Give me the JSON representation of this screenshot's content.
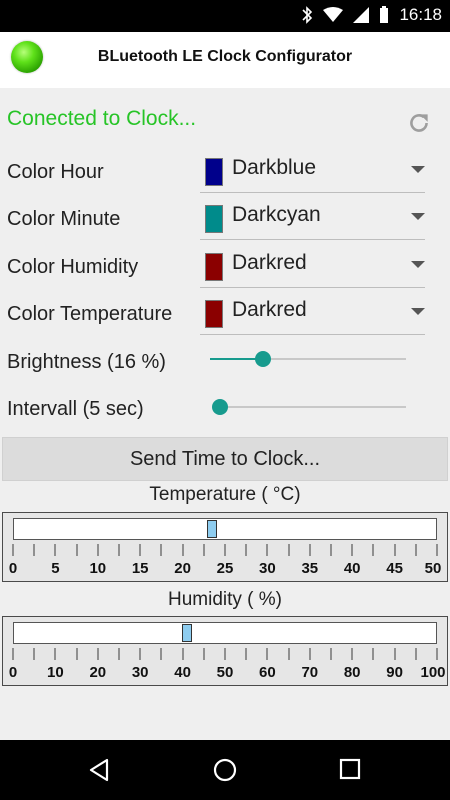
{
  "status_bar": {
    "time": "16:18"
  },
  "app": {
    "title": "BLuetooth LE Clock Configurator"
  },
  "connection": {
    "status": "Conected to Clock..."
  },
  "colors": [
    {
      "label": "Color Hour",
      "value": "Darkblue",
      "color": "#00008b"
    },
    {
      "label": "Color Minute",
      "value": "Darkcyan",
      "color": "#008b8b"
    },
    {
      "label": "Color Humidity",
      "value": "Darkred",
      "color": "#8b0000"
    },
    {
      "label": "Color Temperature",
      "value": "Darkred",
      "color": "#8b0000"
    }
  ],
  "brightness": {
    "label": "Brightness (16 %)",
    "value": 16
  },
  "interval": {
    "label": "Intervall (5 sec)",
    "value_fraction": 0.03
  },
  "send_button": {
    "label": "Send Time to Clock..."
  },
  "temperature": {
    "title": "Temperature ( °C)",
    "min": 0,
    "max": 50,
    "value": 23.5,
    "tick_labels": [
      "0",
      "5",
      "10",
      "15",
      "20",
      "25",
      "30",
      "35",
      "40",
      "45",
      "50"
    ]
  },
  "humidity": {
    "title": "Humidity ( %)",
    "min": 0,
    "max": 100,
    "value": 41,
    "tick_labels": [
      "0",
      "10",
      "20",
      "30",
      "40",
      "50",
      "60",
      "70",
      "80",
      "90",
      "100"
    ]
  },
  "accent_color": "#179b8e",
  "status_color": "#27c427"
}
